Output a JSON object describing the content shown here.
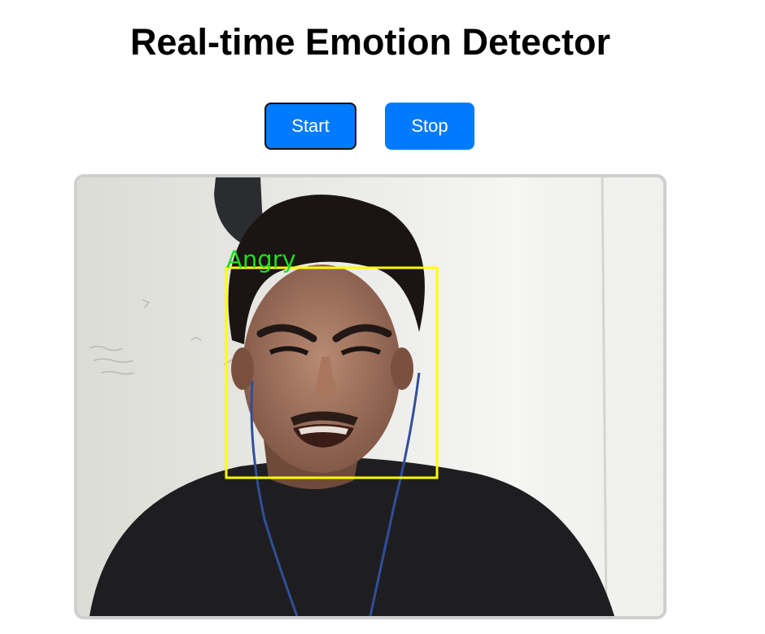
{
  "page": {
    "title": "Real-time Emotion Detector"
  },
  "controls": {
    "start_label": "Start",
    "stop_label": "Stop"
  },
  "video": {
    "detected_emotion": "Angry",
    "box_color": "#ffff00",
    "label_color": "#22dd22"
  },
  "colors": {
    "button_bg": "#007bff",
    "button_text": "#ffffff",
    "frame_border": "#cfcfcf"
  }
}
